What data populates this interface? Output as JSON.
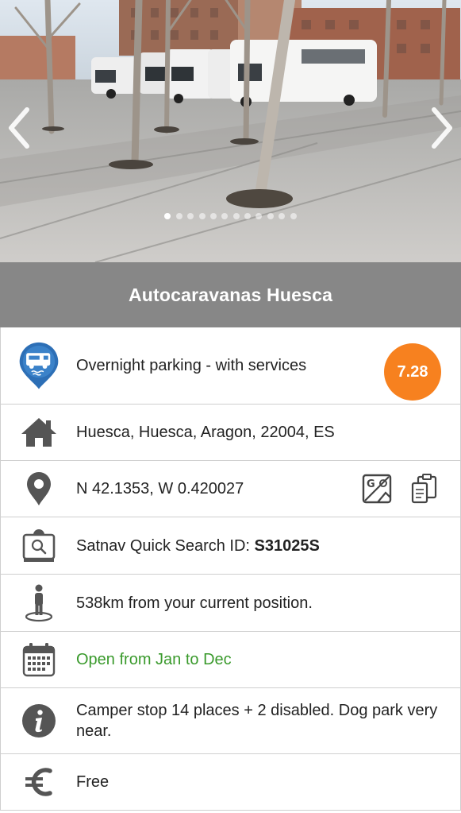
{
  "place": {
    "title": "Autocaravanas Huesca",
    "type": "Overnight parking - with services",
    "rating": "7.28",
    "address": "Huesca, Huesca, Aragon, 22004, ES",
    "coordinates": "N 42.1353, W 0.420027",
    "satnav_label": "Satnav Quick Search ID: ",
    "satnav_id": "S31025S",
    "distance": "538km from your current position.",
    "opening": "Open from Jan to Dec",
    "description": "Camper stop 14 places + 2 disabled. Dog park very near.",
    "price": "Free"
  },
  "gallery": {
    "photo_count": 12,
    "active_index": 0
  },
  "icons": {
    "type": "camper-pin-icon",
    "address": "home-icon",
    "coordinates": "map-pin-icon",
    "map_action": "google-maps-icon",
    "copy_action": "clipboard-copy-icon",
    "satnav": "satnav-icon",
    "distance": "person-location-icon",
    "opening": "calendar-icon",
    "description": "info-icon",
    "price": "euro-icon"
  },
  "colors": {
    "title_band": "#878787",
    "rating_badge": "#f7811f",
    "opening_text": "#3a9a2c",
    "camper_pin": "#2d6fb6"
  }
}
